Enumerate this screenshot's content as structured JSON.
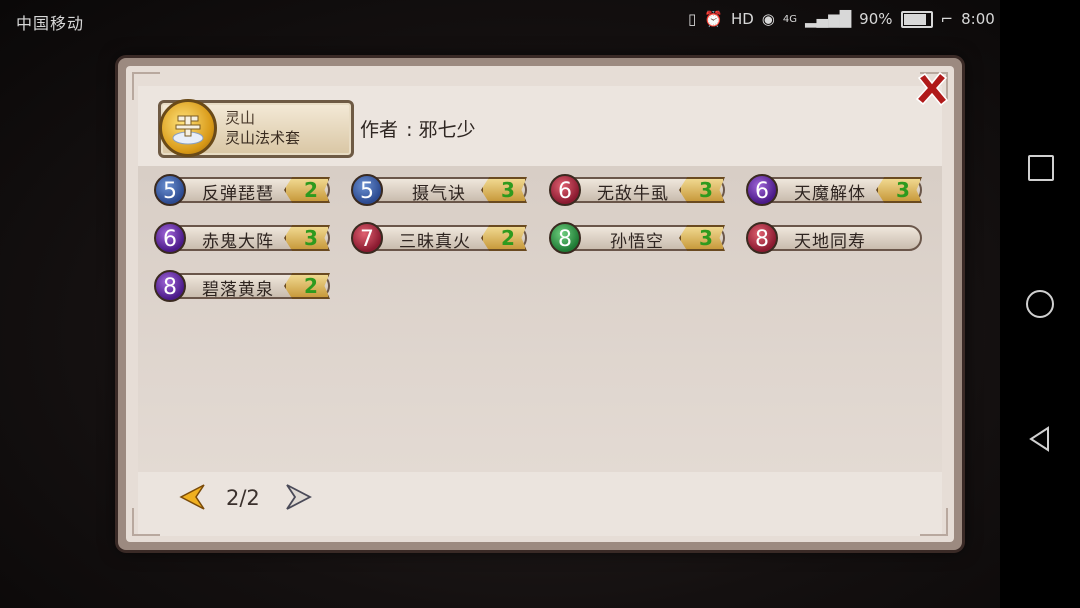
{
  "status_bar": {
    "carrier": "中国移动",
    "network": "4G",
    "battery_percent": "90%",
    "time": "8:00"
  },
  "dialog": {
    "title_line1": "灵山",
    "title_line2": "灵山法术套",
    "author_label": "作者",
    "author_sep": ":",
    "author_name": "邪七少",
    "skills": [
      {
        "level": "5",
        "color": "blue",
        "name": "反弹琵琶",
        "count": "2"
      },
      {
        "level": "5",
        "color": "blue",
        "name": "摄气诀",
        "count": "3"
      },
      {
        "level": "6",
        "color": "red",
        "name": "无敌牛虱",
        "count": "3"
      },
      {
        "level": "6",
        "color": "purple",
        "name": "天魔解体",
        "count": "3"
      },
      {
        "level": "6",
        "color": "purple",
        "name": "赤鬼大阵",
        "count": "3"
      },
      {
        "level": "7",
        "color": "red",
        "name": "三昧真火",
        "count": "2"
      },
      {
        "level": "8",
        "color": "green",
        "name": "孙悟空",
        "count": "3"
      },
      {
        "level": "8",
        "color": "red",
        "name": "天地同寿",
        "count": ""
      },
      {
        "level": "8",
        "color": "purple",
        "name": "碧落黄泉",
        "count": "2"
      }
    ],
    "page": "2/2"
  },
  "icons": {
    "close": "close-x-icon",
    "prev": "arrow-left-icon",
    "next": "arrow-right-icon",
    "school": "lingshan-school-icon"
  },
  "colors": {
    "count_text": "#2e9a1e",
    "close_red": "#b01a1a",
    "prev_arrow": "#e0a020"
  }
}
